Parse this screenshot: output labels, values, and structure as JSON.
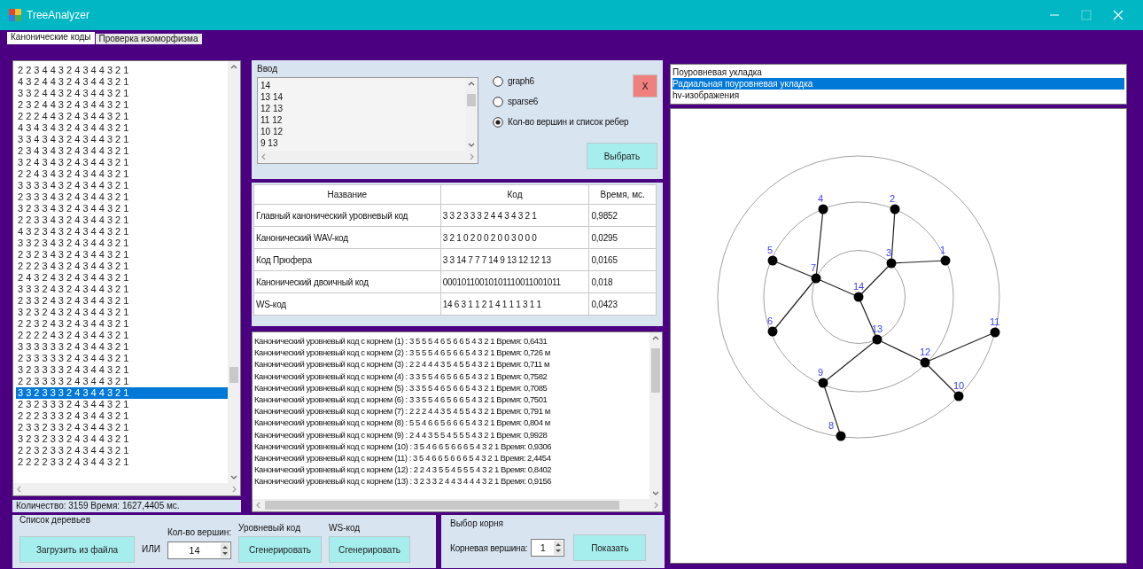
{
  "window": {
    "title": "TreeAnalyzer",
    "maximize_enabled": false
  },
  "tabs": [
    {
      "label": "Канонические коды",
      "selected": true
    },
    {
      "label": "Проверка изоморфизма",
      "selected": false
    }
  ],
  "tree_list": [
    {
      "text": "2 2 3 4 4 3 2 4 3 4 4 3 2 1",
      "selected": false
    },
    {
      "text": "4 3 2 4 4 3 2 4 3 4 4 3 2 1",
      "selected": false
    },
    {
      "text": "3 3 2 4 4 3 2 4 3 4 4 3 2 1",
      "selected": false
    },
    {
      "text": "2 3 2 4 4 3 2 4 3 4 4 3 2 1",
      "selected": false
    },
    {
      "text": "2 2 2 4 4 3 2 4 3 4 4 3 2 1",
      "selected": false
    },
    {
      "text": "4 3 4 3 4 3 2 4 3 4 4 3 2 1",
      "selected": false
    },
    {
      "text": "3 3 4 3 4 3 2 4 3 4 4 3 2 1",
      "selected": false
    },
    {
      "text": "2 3 4 3 4 3 2 4 3 4 4 3 2 1",
      "selected": false
    },
    {
      "text": "3 2 4 3 4 3 2 4 3 4 4 3 2 1",
      "selected": false
    },
    {
      "text": "2 2 4 3 4 3 2 4 3 4 4 3 2 1",
      "selected": false
    },
    {
      "text": "3 3 3 3 4 3 2 4 3 4 4 3 2 1",
      "selected": false
    },
    {
      "text": "2 3 3 3 4 3 2 4 3 4 4 3 2 1",
      "selected": false
    },
    {
      "text": "3 2 3 3 4 3 2 4 3 4 4 3 2 1",
      "selected": false
    },
    {
      "text": "2 2 3 3 4 3 2 4 3 4 4 3 2 1",
      "selected": false
    },
    {
      "text": "4 3 2 3 4 3 2 4 3 4 4 3 2 1",
      "selected": false
    },
    {
      "text": "3 3 2 3 4 3 2 4 3 4 4 3 2 1",
      "selected": false
    },
    {
      "text": "2 3 2 3 4 3 2 4 3 4 4 3 2 1",
      "selected": false
    },
    {
      "text": "2 2 2 3 4 3 2 4 3 4 4 3 2 1",
      "selected": false
    },
    {
      "text": "2 4 3 2 4 3 2 4 3 4 4 3 2 1",
      "selected": false
    },
    {
      "text": "3 3 3 2 4 3 2 4 3 4 4 3 2 1",
      "selected": false
    },
    {
      "text": "2 3 3 2 4 3 2 4 3 4 4 3 2 1",
      "selected": false
    },
    {
      "text": "3 2 3 2 4 3 2 4 3 4 4 3 2 1",
      "selected": false
    },
    {
      "text": "2 2 3 2 4 3 2 4 3 4 4 3 2 1",
      "selected": false
    },
    {
      "text": "2 2 2 2 4 3 2 4 3 4 4 3 2 1",
      "selected": false
    },
    {
      "text": "3 3 3 3 3 3 2 4 3 4 4 3 2 1",
      "selected": false
    },
    {
      "text": "2 3 3 3 3 3 2 4 3 4 4 3 2 1",
      "selected": false
    },
    {
      "text": "3 2 3 3 3 3 2 4 3 4 4 3 2 1",
      "selected": false
    },
    {
      "text": "2 2 3 3 3 3 2 4 3 4 4 3 2 1",
      "selected": false
    },
    {
      "text": "3 3 2 3 3 3 2 4 3 4 4 3 2 1",
      "selected": true
    },
    {
      "text": "2 3 2 3 3 3 2 4 3 4 4 3 2 1",
      "selected": false
    },
    {
      "text": "2 2 2 3 3 3 2 4 3 4 4 3 2 1",
      "selected": false
    },
    {
      "text": "2 3 3 2 3 3 2 4 3 4 4 3 2 1",
      "selected": false
    },
    {
      "text": "3 2 3 2 3 3 2 4 3 4 4 3 2 1",
      "selected": false
    },
    {
      "text": "2 2 3 2 3 3 2 4 3 4 4 3 2 1",
      "selected": false
    },
    {
      "text": "2 2 2 2 3 3 2 4 3 4 4 3 2 1",
      "selected": false
    }
  ],
  "status": "Количество: 3159 Время: 1627,4405 мс.",
  "input_group": {
    "title": "Ввод",
    "lines": [
      "14",
      "13 14",
      "12 13",
      "11 12",
      "10 12",
      "9 13"
    ],
    "formats": [
      {
        "label": "graph6",
        "selected": false
      },
      {
        "label": "sparse6",
        "selected": false
      },
      {
        "label": "Кол-во вершин и список ребер",
        "selected": true
      }
    ],
    "close_button": "X",
    "choose_button": "Выбрать"
  },
  "codes_table": {
    "columns": [
      "Название",
      "Код",
      "Время, мс."
    ],
    "rows": [
      [
        "Главный канонический уровневый код",
        "3 3 2 3 3 3 2 4 4 3 4 3 2 1",
        "0,9852"
      ],
      [
        "Канонический WAV-код",
        "3 2 1 0 2 0 0 2 0 0 3 0 0 0",
        "0,0295"
      ],
      [
        "Код Прюфера",
        "3 3 14 7 7 7 14 9 13 12 12 13",
        "0,0165"
      ],
      [
        "Канонический двоичный код",
        "00010110010101110011001011",
        "0,018"
      ],
      [
        "WS-код",
        "14 6 3 1 1 2 1 4 1 1 1 3 1 1",
        "0,0423"
      ]
    ]
  },
  "root_log": [
    "Канонический уровневый код с корнем (1) : 3 5 5 5 4 6 5 6 6 5 4 3 2 1 Время: 0,6431",
    "Канонический уровневый код с корнем (2) : 3 5 5 5 4 6 5 6 6 5 4 3 2 1 Время: 0,726 м",
    "Канонический уровневый код с корнем (3) : 2 2 4 4 4 3 5 4 5 5 4 3 2 1 Время: 0,711 м",
    "Канонический уровневый код с корнем (4) : 3 3 5 5 4 6 5 6 6 5 4 3 2 1 Время: 0,7582",
    "Канонический уровневый код с корнем (5) : 3 3 5 5 4 6 5 6 6 5 4 3 2 1 Время: 0,7085",
    "Канонический уровневый код с корнем (6) : 3 3 5 5 4 6 5 6 6 5 4 3 2 1 Время: 0,7501",
    "Канонический уровневый код с корнем (7) : 2 2 2 4 4 3 5 4 5 5 4 3 2 1 Время: 0,791 м",
    "Канонический уровневый код с корнем (8) : 5 5 4 6 6 5 6 6 6 5 4 3 2 1 Время: 0,804 м",
    "Канонический уровневый код с корнем (9) : 2 4 4 3 5 5 4 5 5 5 4 3 2 1 Время: 0,9928",
    "Канонический уровневый код с корнем (10) : 3 5 4 6 6 5 6 6 6 5 4 3 2 1 Время: 0,9306",
    "Канонический уровневый код с корнем (11) : 3 5 4 6 6 5 6 6 6 5 4 3 2 1 Время: 2,4454",
    "Канонический уровневый код с корнем (12) : 2 2 4 3 5 5 4 5 5 5 4 3 2 1 Время: 0,8402",
    "Канонический уровневый код с корнем (13) : 3 2 3 3 2 4 4 3 4 4 4 3 2 1 Время: 0,9156"
  ],
  "tree_list_group": {
    "title": "Список деревьев",
    "load_button": "Загрузить из файла",
    "or_label": "ИЛИ",
    "vertex_count_label": "Кол-во вершин:",
    "vertex_count": "14",
    "level_code_label": "Уровневый код",
    "level_generate_button": "Сгенерировать",
    "ws_code_label": "WS-код",
    "ws_generate_button": "Сгенерировать"
  },
  "root_group": {
    "title": "Выбор корня",
    "root_label": "Корневая вершина:",
    "root_value": "1",
    "show_button": "Показать"
  },
  "layouts": [
    {
      "label": "Поуровневая укладка",
      "selected": false
    },
    {
      "label": "Радиальная поуровневая укладка",
      "selected": true
    },
    {
      "label": "hv-изображения",
      "selected": false
    }
  ],
  "graph": {
    "nodes": [
      "1",
      "2",
      "3",
      "4",
      "5",
      "6",
      "7",
      "8",
      "9",
      "10",
      "11",
      "12",
      "13",
      "14"
    ]
  }
}
